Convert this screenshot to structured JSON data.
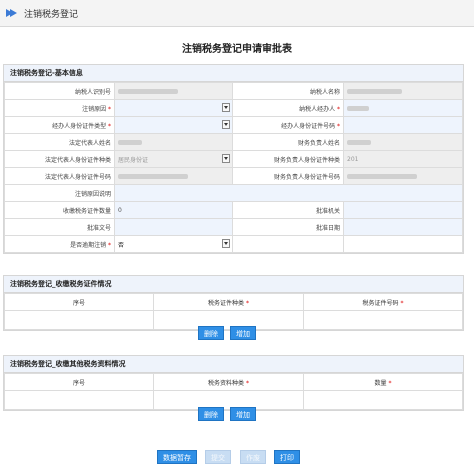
{
  "tab": {
    "title": "注销税务登记"
  },
  "page_title": "注销税务登记申请审批表",
  "basic": {
    "header": "注销税务登记-基本信息",
    "taxpayer_id_label": "纳税人识别号",
    "taxpayer_name_label": "纳税人名称",
    "reason_label": "注销原因",
    "agent_label": "纳税人经办人",
    "agent_id_type_label": "经办人身份证件类型",
    "agent_id_no_label": "经办人身份证件号码",
    "legal_rep_label": "法定代表人姓名",
    "fin_head_label": "财务负责人姓名",
    "legal_id_type_label": "法定代表人身份证件种类",
    "legal_id_type_value": "居民身份证",
    "fin_id_type_label": "财务负责人身份证件种类",
    "fin_id_type_value": "201",
    "legal_id_no_label": "法定代表人身份证件号码",
    "fin_id_no_label": "财务负责人身份证件号码",
    "reason_desc_label": "注销原因说明",
    "cert_count_label": "收缴税务证件数量",
    "cert_count_value": "0",
    "approve_org_label": "批准机关",
    "approve_doc_label": "批准文号",
    "approve_date_label": "批准日期",
    "overdue_label": "是否逾期注销",
    "overdue_value": "否",
    "required_mark": "*"
  },
  "certs": {
    "header": "注销税务登记_收缴税务证件情况",
    "cols": [
      "序号",
      "税务证件种类",
      "税务证件号码"
    ],
    "delete_label": "删除",
    "add_label": "增加"
  },
  "docs": {
    "header": "注销税务登记_收缴其他税务资料情况",
    "cols": [
      "序号",
      "税务资料种类",
      "数量"
    ],
    "delete_label": "删除",
    "add_label": "增加"
  },
  "footer": {
    "save_label": "数据暂存",
    "submit_label": "提交",
    "void_label": "作废",
    "print_label": "打印"
  },
  "colors": {
    "accent": "#2f8fe6",
    "input_bg": "#eef4fd",
    "readonly_bg": "#eeeeee",
    "required": "#dd0000"
  }
}
